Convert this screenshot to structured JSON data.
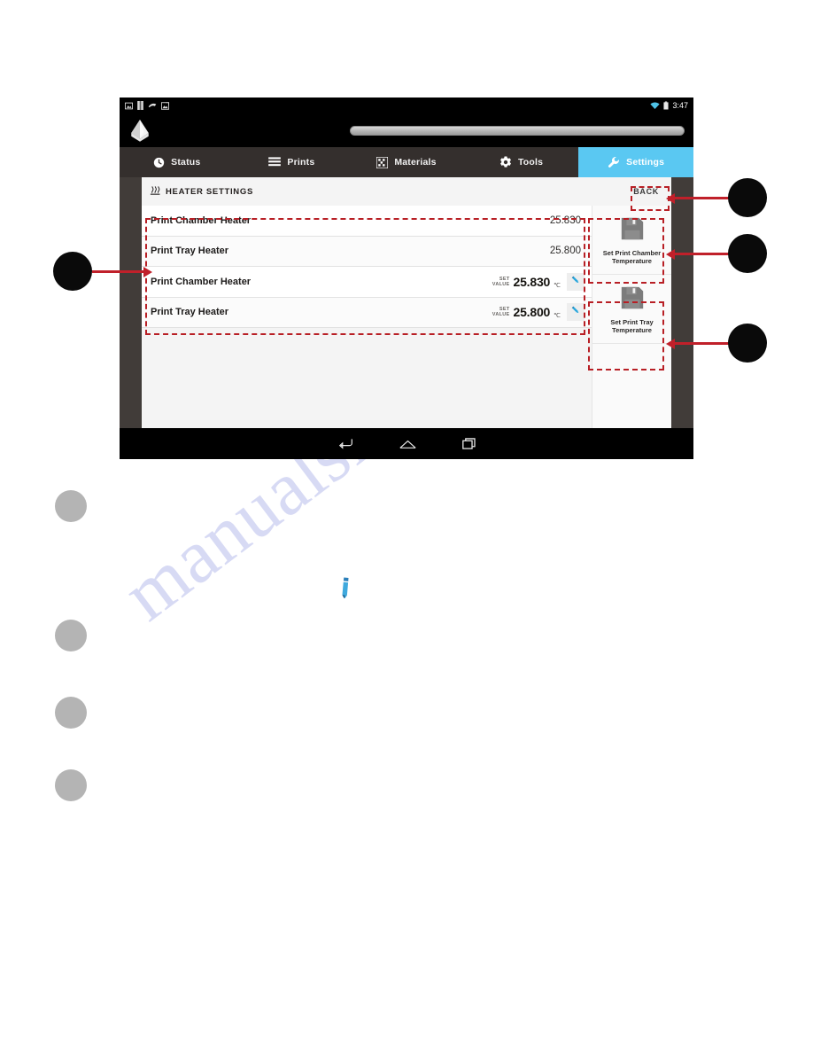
{
  "page": {
    "watermark_text": "manualshive.com",
    "watermark_icon": "pencil-icon"
  },
  "device": {
    "status_bar": {
      "left_icons": [
        "screenshot-icon",
        "sim-card-icon",
        "usb-debug-icon",
        "image-icon"
      ],
      "right_icons": [
        "wifi-icon",
        "battery-icon"
      ],
      "clock": "3:47"
    },
    "app_bar": {
      "logo_icon": "printer-logo-icon",
      "progress_track": "progress-bar-track"
    },
    "nav_bar": {
      "keys": [
        {
          "name": "back-key",
          "icon": "back-arrow-icon"
        },
        {
          "name": "home-key",
          "icon": "home-icon"
        },
        {
          "name": "recents-key",
          "icon": "recent-apps-icon"
        }
      ]
    }
  },
  "tabs": [
    {
      "label": "Status",
      "icon": "clock-icon",
      "active": false
    },
    {
      "label": "Prints",
      "icon": "list-lines-icon",
      "active": false
    },
    {
      "label": "Materials",
      "icon": "grid-dots-icon",
      "active": false
    },
    {
      "label": "Tools",
      "icon": "gear-icon",
      "active": false
    },
    {
      "label": "Settings",
      "icon": "wrench-icon",
      "active": true
    }
  ],
  "panel": {
    "title": "HEATER SETTINGS",
    "title_icon": "heat-waves-icon",
    "back_label": "BACK",
    "readings": [
      {
        "label": "Print Chamber Heater",
        "value": "25.830"
      },
      {
        "label": "Print Tray Heater",
        "value": "25.800"
      }
    ],
    "set_values": [
      {
        "label": "Print Chamber Heater",
        "tag_line1": "SET",
        "tag_line2": "VALUE",
        "value": "25.830",
        "unit": "℃",
        "edit_icon": "pencil-icon"
      },
      {
        "label": "Print Tray Heater",
        "tag_line1": "SET",
        "tag_line2": "VALUE",
        "value": "25.800",
        "unit": "℃",
        "edit_icon": "pencil-icon"
      }
    ],
    "side_buttons": [
      {
        "line1": "Set Print Chamber",
        "line2": "Temperature",
        "icon": "save-floppy-icon"
      },
      {
        "line1": "Set Print Tray",
        "line2": "Temperature",
        "icon": "save-floppy-icon"
      }
    ]
  },
  "annotation": {
    "highlight_color": "#b81f25",
    "leader_color": "#c0202a",
    "callout_dot_black": "#0a0a0a",
    "callout_dot_gray": "#b4b4b4"
  },
  "accent": {
    "settings_tab": "#5ac8f2",
    "edit_pencil": "#2aa7dd",
    "panel_bg": "#f4f4f4",
    "tab_strip_bg": "#342f2d"
  }
}
